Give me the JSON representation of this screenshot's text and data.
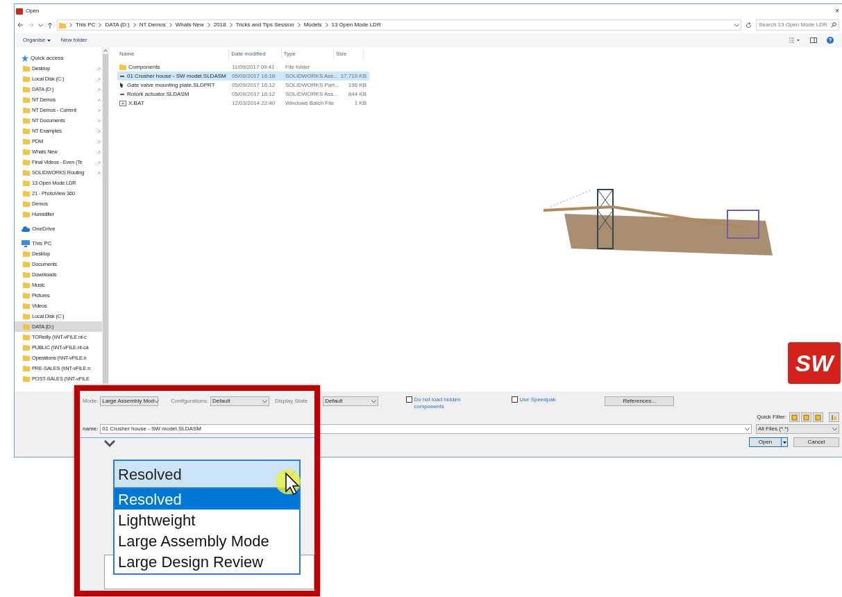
{
  "window": {
    "title": "Open",
    "close": "×"
  },
  "address": {
    "path": [
      "This PC",
      "DATA (D:)",
      "NT Demos",
      "Whats New",
      "2018",
      "Tricks and Tips Session",
      "Models",
      "13 Open Mode LDR"
    ],
    "search_placeholder": "Search 13 Open Mode LDR"
  },
  "toolbar": {
    "organise": "Organise",
    "new_folder": "New folder"
  },
  "sidebar": {
    "groups": [
      {
        "label": "Quick access",
        "items": [
          {
            "label": "Desktop",
            "pinned": true,
            "selected": false
          },
          {
            "label": "Local Disk (C:)",
            "pinned": true,
            "selected": false
          },
          {
            "label": "DATA (D:)",
            "pinned": true,
            "selected": false
          },
          {
            "label": "NT Demos",
            "pinned": true,
            "selected": false
          },
          {
            "label": "NT Demos - Current",
            "pinned": true,
            "selected": false
          },
          {
            "label": "NT Documents",
            "pinned": true,
            "selected": false
          },
          {
            "label": "NT Examples",
            "pinned": true,
            "selected": false
          },
          {
            "label": "PDM",
            "pinned": true,
            "selected": false
          },
          {
            "label": "Whats New",
            "pinned": true,
            "selected": false
          },
          {
            "label": "Final Videos - Even (Te",
            "pinned": true,
            "selected": false
          },
          {
            "label": "SOLIDWORKS Routing",
            "pinned": true,
            "selected": false
          },
          {
            "label": "13 Open Mode LDR",
            "pinned": false,
            "selected": false
          },
          {
            "label": "21 - PhotoView 360",
            "pinned": false,
            "selected": false
          },
          {
            "label": "Demos",
            "pinned": false,
            "selected": false
          },
          {
            "label": "Humidifier",
            "pinned": false,
            "selected": false
          }
        ]
      },
      {
        "label": "OneDrive"
      },
      {
        "label": "This PC",
        "items": [
          {
            "label": "Desktop",
            "pinned": false,
            "selected": false
          },
          {
            "label": "Documents",
            "pinned": false,
            "selected": false
          },
          {
            "label": "Downloads",
            "pinned": false,
            "selected": false
          },
          {
            "label": "Music",
            "pinned": false,
            "selected": false
          },
          {
            "label": "Pictures",
            "pinned": false,
            "selected": false
          },
          {
            "label": "Videos",
            "pinned": false,
            "selected": false
          },
          {
            "label": "Local Disk (C:)",
            "pinned": false,
            "selected": false
          },
          {
            "label": "DATA (D:)",
            "pinned": false,
            "selected": true
          },
          {
            "label": "TOReilly (\\\\NT-vFILE.nt-c",
            "pinned": false,
            "selected": false
          },
          {
            "label": "PUBLIC (\\\\NT-vFILE.nt-ca",
            "pinned": false,
            "selected": false
          },
          {
            "label": "Operations (\\\\NT-vFILE.n",
            "pinned": false,
            "selected": false
          },
          {
            "label": "PRE-SALES (\\\\NT-vFILE.n",
            "pinned": false,
            "selected": false
          },
          {
            "label": "POST-SALES (\\\\NT-vFILE",
            "pinned": false,
            "selected": false
          }
        ]
      }
    ]
  },
  "table": {
    "columns": [
      "Name",
      "Date modified",
      "Type",
      "Size"
    ],
    "rows": [
      {
        "kind": "folder",
        "cells": [
          "Components",
          "11/09/2017 09:41",
          "File folder",
          ""
        ],
        "selected": false
      },
      {
        "kind": "assembly",
        "cells": [
          "01 Crusher house - SW model.SLDASM",
          "05/09/2017 16:18",
          "SOLIDWORKS Ass...",
          "17,719 KB"
        ],
        "selected": true
      },
      {
        "kind": "part",
        "cells": [
          "Gate valve mounting plate.SLDPRT",
          "05/09/2017 16:12",
          "SOLIDWORKS Part...",
          "196 KB"
        ],
        "selected": false
      },
      {
        "kind": "assembly",
        "cells": [
          "Rotork actuator.SLDASM",
          "05/09/2017 16:12",
          "SOLIDWORKS Ass...",
          "844 KB"
        ],
        "selected": false
      },
      {
        "kind": "batch",
        "cells": [
          "X.BAT",
          "12/03/2014 22:40",
          "Windows Batch File",
          "1 KB"
        ],
        "selected": false
      }
    ]
  },
  "preview": {
    "logo_text": "SW"
  },
  "options": {
    "mode_label": "Mode:",
    "mode": "Large Assembly Mod",
    "config_label": "Configurations:",
    "config": "Default",
    "display_label": "Display State",
    "display": "Default",
    "checks": [
      {
        "label": "Do not load hidden components",
        "checked": false
      },
      {
        "label": "Use Speedpak",
        "checked": false
      }
    ],
    "references": "References...",
    "quick_filter": "Quick Filter:"
  },
  "file": {
    "label": "name:",
    "value": "01 Crusher house - SW model.SLDASM",
    "type": "All Files (*.*)",
    "open": "Open",
    "cancel": "Cancel"
  },
  "magnifier": {
    "value": "Resolved",
    "options": [
      {
        "label": "Resolved",
        "selected": true
      },
      {
        "label": "Lightweight",
        "selected": false
      },
      {
        "label": "Large Assembly Mode",
        "selected": false
      },
      {
        "label": "Large Design Review",
        "selected": false
      }
    ]
  }
}
